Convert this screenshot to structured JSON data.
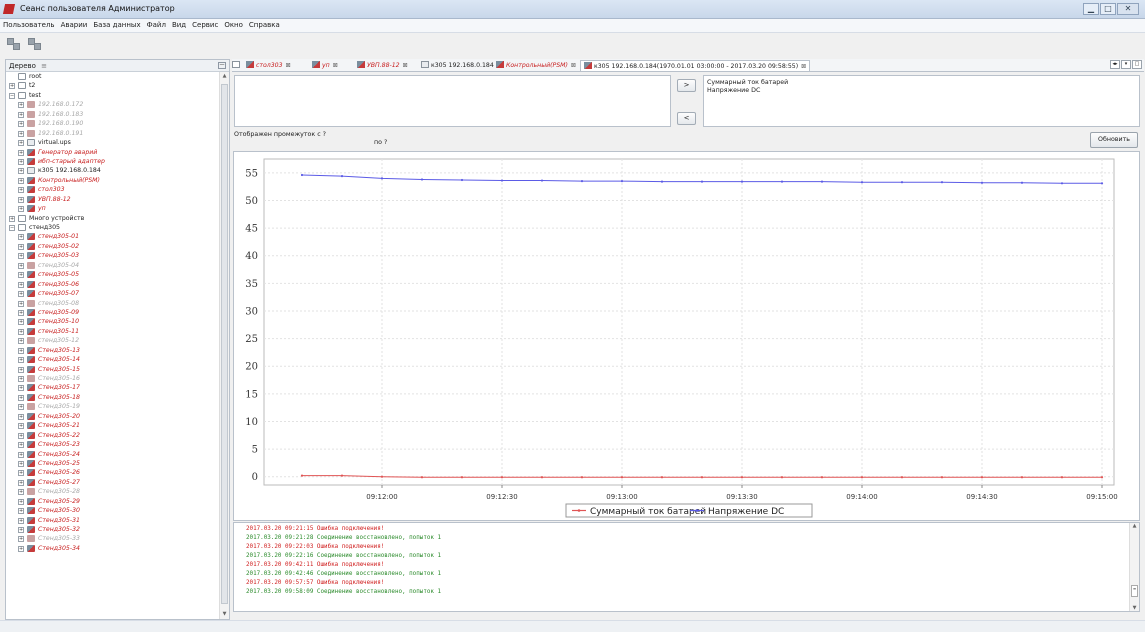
{
  "window": {
    "title": "Сеанс пользователя Администратор",
    "controls": [
      "minimize-icon",
      "maximize-icon",
      "close-icon"
    ]
  },
  "menu": [
    "Пользователь",
    "Аварии",
    "База данных",
    "Файл",
    "Вид",
    "Сервис",
    "Окно",
    "Справка"
  ],
  "tree": {
    "header": "Дерево",
    "items": [
      {
        "label": "root",
        "level": 0,
        "exp": "",
        "icon": "folder",
        "style": "black"
      },
      {
        "label": "t2",
        "level": 0,
        "exp": "+",
        "icon": "folder",
        "style": "black"
      },
      {
        "label": "test",
        "level": 0,
        "exp": "−",
        "icon": "folder",
        "style": "black"
      },
      {
        "label": "192.168.0.172",
        "level": 1,
        "exp": "+",
        "icon": "devgray",
        "style": "gray"
      },
      {
        "label": "192.168.0.183",
        "level": 1,
        "exp": "+",
        "icon": "devgray",
        "style": "gray"
      },
      {
        "label": "192.168.0.190",
        "level": 1,
        "exp": "+",
        "icon": "devgray",
        "style": "gray"
      },
      {
        "label": "192.168.0.191",
        "level": 1,
        "exp": "+",
        "icon": "devgray",
        "style": "gray"
      },
      {
        "label": "virtual.ups",
        "level": 1,
        "exp": "+",
        "icon": "plain",
        "style": "black"
      },
      {
        "label": "Генератор аварий",
        "level": 1,
        "exp": "+",
        "icon": "img",
        "style": "red"
      },
      {
        "label": "ибп-старый адаптер",
        "level": 1,
        "exp": "+",
        "icon": "img",
        "style": "red"
      },
      {
        "label": "к305 192.168.0.184",
        "level": 1,
        "exp": "+",
        "icon": "plain",
        "style": "black"
      },
      {
        "label": "Контрольный(PSM)",
        "level": 1,
        "exp": "+",
        "icon": "img",
        "style": "red"
      },
      {
        "label": "стол303",
        "level": 1,
        "exp": "+",
        "icon": "img",
        "style": "red"
      },
      {
        "label": "УВП.88-12",
        "level": 1,
        "exp": "+",
        "icon": "img",
        "style": "red"
      },
      {
        "label": "уп",
        "level": 1,
        "exp": "+",
        "icon": "img",
        "style": "red"
      },
      {
        "label": "Много устройств",
        "level": 0,
        "exp": "+",
        "icon": "folder",
        "style": "black"
      },
      {
        "label": "стенд305",
        "level": 0,
        "exp": "−",
        "icon": "folder",
        "style": "black"
      },
      {
        "label": "стенд305-01",
        "level": 1,
        "exp": "+",
        "icon": "img",
        "style": "red"
      },
      {
        "label": "стенд305-02",
        "level": 1,
        "exp": "+",
        "icon": "img",
        "style": "red"
      },
      {
        "label": "стенд305-03",
        "level": 1,
        "exp": "+",
        "icon": "img",
        "style": "red"
      },
      {
        "label": "стенд305-04",
        "level": 1,
        "exp": "+",
        "icon": "devgray",
        "style": "gray"
      },
      {
        "label": "стенд305-05",
        "level": 1,
        "exp": "+",
        "icon": "img",
        "style": "red"
      },
      {
        "label": "стенд305-06",
        "level": 1,
        "exp": "+",
        "icon": "img",
        "style": "red"
      },
      {
        "label": "стенд305-07",
        "level": 1,
        "exp": "+",
        "icon": "img",
        "style": "red"
      },
      {
        "label": "стенд305-08",
        "level": 1,
        "exp": "+",
        "icon": "devgray",
        "style": "gray"
      },
      {
        "label": "стенд305-09",
        "level": 1,
        "exp": "+",
        "icon": "img",
        "style": "red"
      },
      {
        "label": "стенд305-10",
        "level": 1,
        "exp": "+",
        "icon": "img",
        "style": "red"
      },
      {
        "label": "стенд305-11",
        "level": 1,
        "exp": "+",
        "icon": "img",
        "style": "red"
      },
      {
        "label": "стенд305-12",
        "level": 1,
        "exp": "+",
        "icon": "devgray",
        "style": "gray"
      },
      {
        "label": "Стенд305-13",
        "level": 1,
        "exp": "+",
        "icon": "img",
        "style": "red"
      },
      {
        "label": "Стенд305-14",
        "level": 1,
        "exp": "+",
        "icon": "img",
        "style": "red"
      },
      {
        "label": "Стенд305-15",
        "level": 1,
        "exp": "+",
        "icon": "img",
        "style": "red"
      },
      {
        "label": "Стенд305-16",
        "level": 1,
        "exp": "+",
        "icon": "devgray",
        "style": "gray"
      },
      {
        "label": "Стенд305-17",
        "level": 1,
        "exp": "+",
        "icon": "img",
        "style": "red"
      },
      {
        "label": "Стенд305-18",
        "level": 1,
        "exp": "+",
        "icon": "img",
        "style": "red"
      },
      {
        "label": "Стенд305-19",
        "level": 1,
        "exp": "+",
        "icon": "devgray",
        "style": "gray"
      },
      {
        "label": "Стенд305-20",
        "level": 1,
        "exp": "+",
        "icon": "img",
        "style": "red"
      },
      {
        "label": "Стенд305-21",
        "level": 1,
        "exp": "+",
        "icon": "img",
        "style": "red"
      },
      {
        "label": "Стенд305-22",
        "level": 1,
        "exp": "+",
        "icon": "img",
        "style": "red"
      },
      {
        "label": "Стенд305-23",
        "level": 1,
        "exp": "+",
        "icon": "img",
        "style": "red"
      },
      {
        "label": "Стенд305-24",
        "level": 1,
        "exp": "+",
        "icon": "img",
        "style": "red"
      },
      {
        "label": "Стенд305-25",
        "level": 1,
        "exp": "+",
        "icon": "img",
        "style": "red"
      },
      {
        "label": "Стенд305-26",
        "level": 1,
        "exp": "+",
        "icon": "img",
        "style": "red"
      },
      {
        "label": "Стенд305-27",
        "level": 1,
        "exp": "+",
        "icon": "img",
        "style": "red"
      },
      {
        "label": "Стенд305-28",
        "level": 1,
        "exp": "+",
        "icon": "devgray",
        "style": "gray"
      },
      {
        "label": "Стенд305-29",
        "level": 1,
        "exp": "+",
        "icon": "img",
        "style": "red"
      },
      {
        "label": "Стенд305-30",
        "level": 1,
        "exp": "+",
        "icon": "img",
        "style": "red"
      },
      {
        "label": "Стенд305-31",
        "level": 1,
        "exp": "+",
        "icon": "img",
        "style": "red"
      },
      {
        "label": "Стенд305-32",
        "level": 1,
        "exp": "+",
        "icon": "img",
        "style": "red"
      },
      {
        "label": "Стенд305-33",
        "level": 1,
        "exp": "+",
        "icon": "devgray",
        "style": "gray"
      },
      {
        "label": "Стенд305-34",
        "level": 1,
        "exp": "+",
        "icon": "img",
        "style": "red"
      }
    ]
  },
  "tabs": [
    {
      "label": "стол303",
      "style": "red"
    },
    {
      "label": "уп",
      "style": "red"
    },
    {
      "label": "УВП.88-12",
      "style": "red"
    },
    {
      "label": "к305 192.168.0.184",
      "style": "black"
    },
    {
      "label": "Контрольный(PSM)",
      "style": "red"
    },
    {
      "label": "к305 192.168.0.184(1970.01.01 03:00:00 - 2017.03.20 09:58:55)",
      "style": "active"
    }
  ],
  "series_selector": {
    "move_right": ">",
    "move_left": "<",
    "selected": [
      "Суммарный ток батарей",
      "Напряжение DC"
    ]
  },
  "range": {
    "from_label": "Отображен промежуток с ?",
    "to_label": "по ?"
  },
  "refresh_label": "Обновить",
  "colors": {
    "voltage": "#5b5be6",
    "current": "#e05454",
    "error_text": "#d02020",
    "ok_text": "#2a8a2a"
  },
  "chart_data": {
    "type": "line",
    "x": [
      "09:11:40",
      "09:11:50",
      "09:12:00",
      "09:12:10",
      "09:12:20",
      "09:12:30",
      "09:12:40",
      "09:12:50",
      "09:13:00",
      "09:13:10",
      "09:13:20",
      "09:13:30",
      "09:13:40",
      "09:13:50",
      "09:14:00",
      "09:14:10",
      "09:14:20",
      "09:14:30",
      "09:14:40",
      "09:14:50",
      "09:15:00"
    ],
    "x_ticks": [
      "09:12:00",
      "09:12:30",
      "09:13:00",
      "09:13:30",
      "09:14:00",
      "09:14:30",
      "09:15:00"
    ],
    "y_ticks": [
      0,
      5,
      10,
      15,
      20,
      25,
      30,
      35,
      40,
      45,
      50,
      55
    ],
    "ylim": [
      -1.5,
      57.5
    ],
    "grid": true,
    "legend_position": "bottom-center",
    "series": [
      {
        "name": "Суммарный ток батарей",
        "color": "#e05454",
        "values": [
          0.2,
          0.2,
          0.0,
          -0.1,
          -0.1,
          -0.1,
          -0.1,
          -0.1,
          -0.1,
          -0.1,
          -0.1,
          -0.1,
          -0.1,
          -0.1,
          -0.1,
          -0.1,
          -0.1,
          -0.1,
          -0.1,
          -0.1,
          -0.1
        ]
      },
      {
        "name": "Напряжение DC",
        "color": "#5b5be6",
        "values": [
          54.6,
          54.4,
          54.0,
          53.8,
          53.7,
          53.6,
          53.6,
          53.5,
          53.5,
          53.4,
          53.4,
          53.4,
          53.4,
          53.4,
          53.3,
          53.3,
          53.3,
          53.2,
          53.2,
          53.1,
          53.1
        ]
      }
    ]
  },
  "log": [
    {
      "text": "2017.03.20 09:21:15 Ошибка подключения!",
      "type": "err"
    },
    {
      "text": "2017.03.20 09:21:28 Соединение восстановлено, попыток 1",
      "type": "ok"
    },
    {
      "text": "2017.03.20 09:22:03 Ошибка подключения!",
      "type": "err"
    },
    {
      "text": "2017.03.20 09:22:16 Соединение восстановлено, попыток 1",
      "type": "ok"
    },
    {
      "text": "2017.03.20 09:42:11 Ошибка подключения!",
      "type": "err"
    },
    {
      "text": "2017.03.20 09:42:46 Соединение восстановлено, попыток 1",
      "type": "ok"
    },
    {
      "text": "2017.03.20 09:57:57 Ошибка подключения!",
      "type": "err"
    },
    {
      "text": "2017.03.20 09:58:09 Соединение восстановлено, попыток 1",
      "type": "ok"
    }
  ]
}
